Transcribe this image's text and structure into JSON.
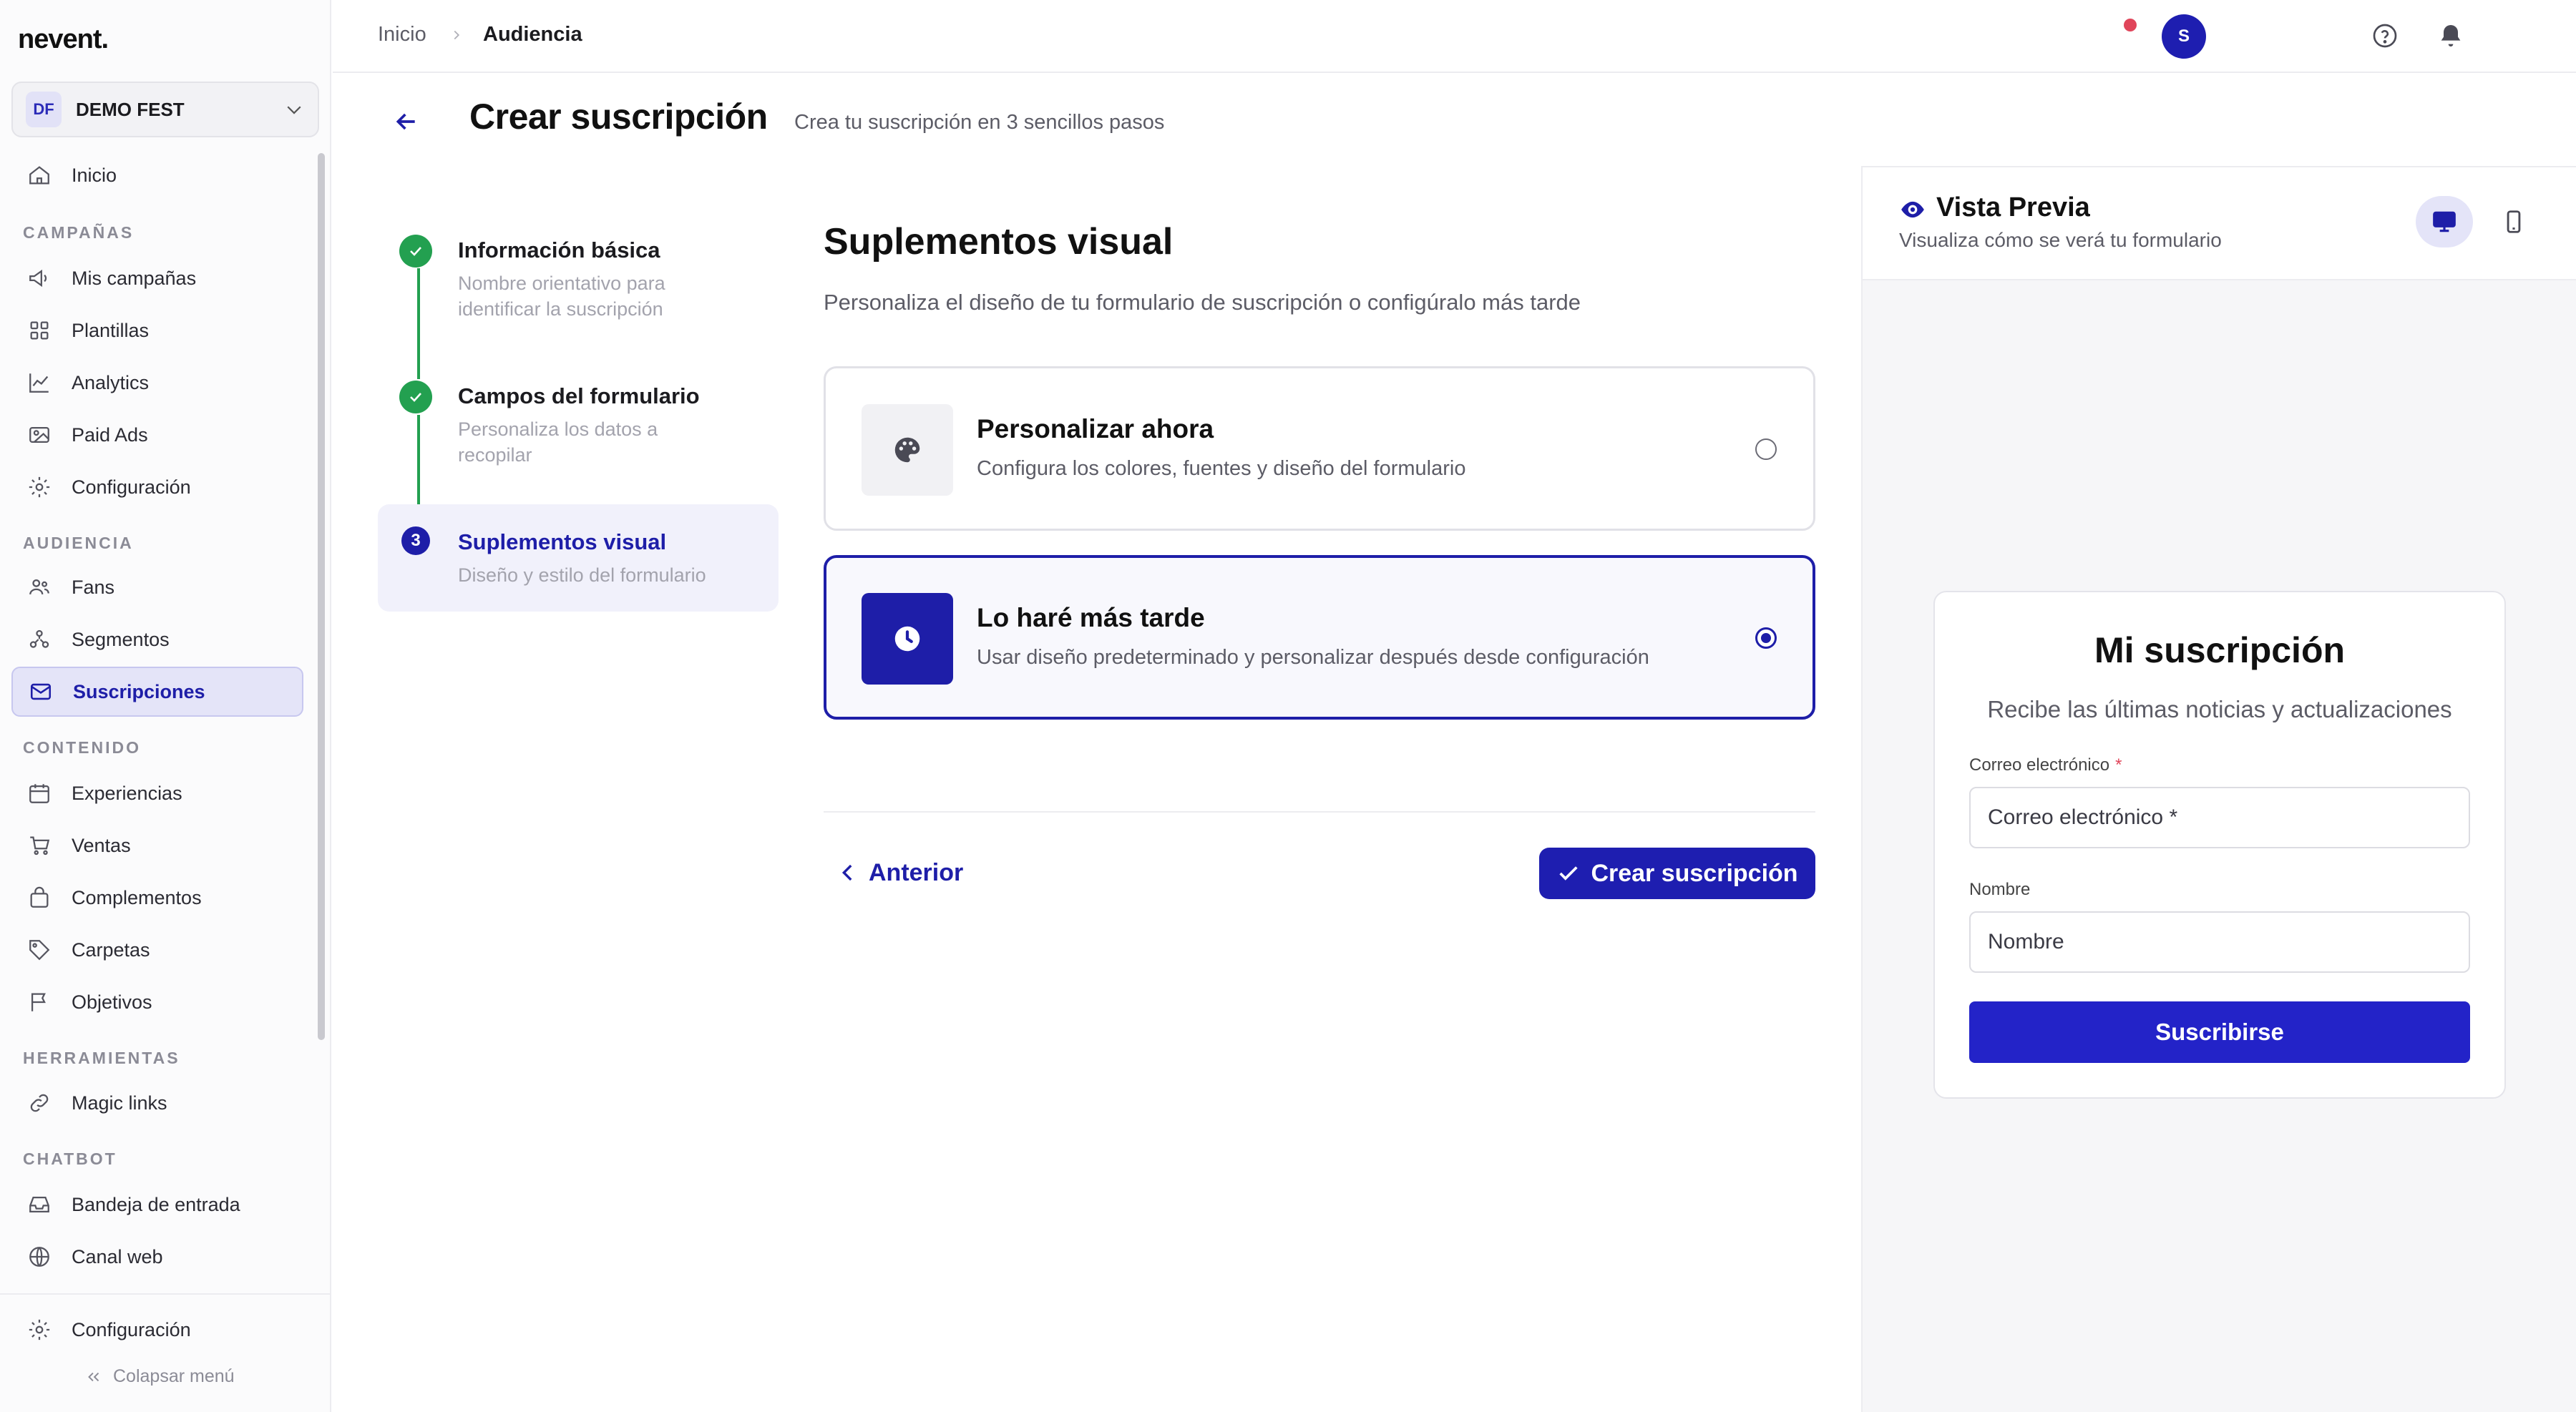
{
  "app": {
    "logo": "nevent."
  },
  "org": {
    "initials": "DF",
    "name": "DEMO FEST"
  },
  "sidebar": {
    "items": [
      {
        "label": "Inicio",
        "icon": "home-icon"
      },
      {
        "section": "CAMPAÑAS"
      },
      {
        "label": "Mis campañas",
        "icon": "megaphone-icon"
      },
      {
        "label": "Plantillas",
        "icon": "grid-icon"
      },
      {
        "label": "Analytics",
        "icon": "chart-line-icon"
      },
      {
        "label": "Paid Ads",
        "icon": "image-ads-icon"
      },
      {
        "label": "Configuración",
        "icon": "gear-icon"
      },
      {
        "section": "AUDIENCIA"
      },
      {
        "label": "Fans",
        "icon": "users-icon"
      },
      {
        "label": "Segmentos",
        "icon": "segments-icon"
      },
      {
        "label": "Suscripciones",
        "icon": "mail-icon",
        "active": true
      },
      {
        "section": "CONTENIDO"
      },
      {
        "label": "Experiencias",
        "icon": "calendar-icon"
      },
      {
        "label": "Ventas",
        "icon": "cart-icon"
      },
      {
        "label": "Complementos",
        "icon": "bag-icon"
      },
      {
        "label": "Carpetas",
        "icon": "tag-icon"
      },
      {
        "label": "Objetivos",
        "icon": "flag-icon"
      },
      {
        "section": "HERRAMIENTAS"
      },
      {
        "label": "Magic links",
        "icon": "link-icon"
      },
      {
        "section": "CHATBOT"
      },
      {
        "label": "Bandeja de entrada",
        "icon": "inbox-icon"
      },
      {
        "label": "Canal web",
        "icon": "globe-icon"
      }
    ],
    "footer_settings": "Configuración",
    "collapse": "Colapsar menú"
  },
  "breadcrumb": {
    "home": "Inicio",
    "current": "Audiencia"
  },
  "header": {
    "title": "Crear suscripción",
    "subtitle": "Crea tu suscripción en 3 sencillos pasos",
    "avatar": "S"
  },
  "steps": [
    {
      "title": "Información básica",
      "desc": "Nombre orientativo para identificar la suscripción",
      "status": "done"
    },
    {
      "title": "Campos del formulario",
      "desc": "Personaliza los datos a recopilar",
      "status": "done"
    },
    {
      "number": "3",
      "title": "Suplementos visual",
      "desc": "Diseño y estilo del formulario",
      "status": "current"
    }
  ],
  "main": {
    "title": "Suplementos visual",
    "subtitle": "Personaliza el diseño de tu formulario de suscripción o configúralo más tarde",
    "options": [
      {
        "title": "Personalizar ahora",
        "desc": "Configura los colores, fuentes y diseño del formulario",
        "selected": false
      },
      {
        "title": "Lo haré más tarde",
        "desc": "Usar diseño predeterminado y personalizar después desde configuración",
        "selected": true
      }
    ],
    "prev_label": "Anterior",
    "create_label": "Crear suscripción"
  },
  "preview": {
    "title": "Vista Previa",
    "subtitle": "Visualiza cómo se verá tu formulario",
    "form": {
      "title": "Mi suscripción",
      "subtitle": "Recibe las últimas noticias y actualizaciones",
      "email_label": "Correo electrónico",
      "email_required": "*",
      "email_placeholder": "Correo electrónico *",
      "name_label": "Nombre",
      "name_placeholder": "Nombre",
      "submit": "Suscribirse"
    }
  },
  "colors": {
    "accent": "#1e1eb0",
    "success": "#23a050",
    "danger": "#e0455a"
  }
}
